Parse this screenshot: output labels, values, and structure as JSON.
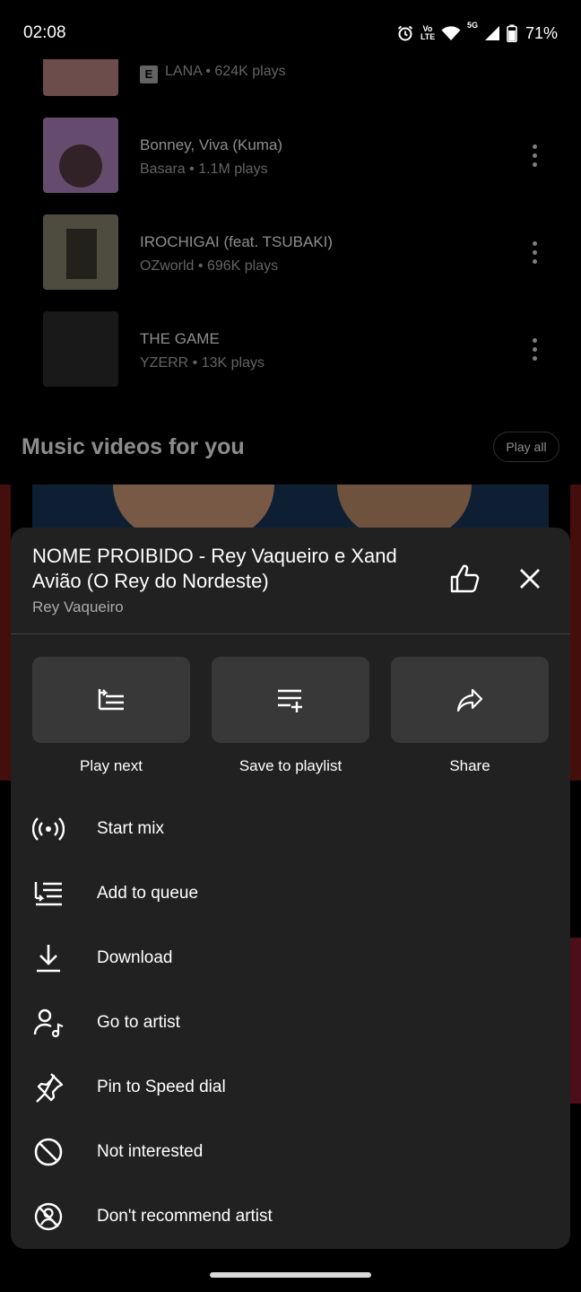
{
  "status_bar": {
    "time": "02:08",
    "network_label": "5G",
    "volte_label": "Vo LTE",
    "battery": "71%"
  },
  "songs": [
    {
      "title": "",
      "artist": "LANA",
      "plays": "624K plays",
      "explicit_label": "E",
      "thumb_color": "#c78a8a"
    },
    {
      "title": "Bonney, Viva (Kuma)",
      "artist": "Basara",
      "plays": "1.1M plays",
      "thumb_color": "#b889c9"
    },
    {
      "title": "IROCHIGAI (feat. TSUBAKI)",
      "artist": "OZworld",
      "plays": "696K plays",
      "thumb_color": "#8c8a74"
    },
    {
      "title": "THE GAME",
      "artist": "YZERR",
      "plays": "13K plays",
      "thumb_color": "#2e2e2e"
    }
  ],
  "section": {
    "title": "Music videos for you",
    "play_all": "Play all"
  },
  "sheet": {
    "title": "NOME PROIBIDO - Rey Vaqueiro e Xand Avião (O Rey do Nordeste)",
    "artist": "Rey Vaqueiro",
    "actions": [
      {
        "label": "Play next",
        "icon": "play-next-icon"
      },
      {
        "label": "Save to playlist",
        "icon": "playlist-add-icon"
      },
      {
        "label": "Share",
        "icon": "share-icon"
      }
    ],
    "menu": [
      {
        "label": "Start mix",
        "icon": "radio-icon"
      },
      {
        "label": "Add to queue",
        "icon": "queue-icon"
      },
      {
        "label": "Download",
        "icon": "download-icon"
      },
      {
        "label": "Go to artist",
        "icon": "artist-icon"
      },
      {
        "label": "Pin to Speed dial",
        "icon": "pin-icon"
      },
      {
        "label": "Not interested",
        "icon": "block-icon"
      },
      {
        "label": "Don't recommend artist",
        "icon": "dont-recommend-icon"
      }
    ]
  },
  "colors": {
    "sheet_bg": "#212121",
    "card_bg": "#383838",
    "secondary_text": "#aaaaaa"
  }
}
